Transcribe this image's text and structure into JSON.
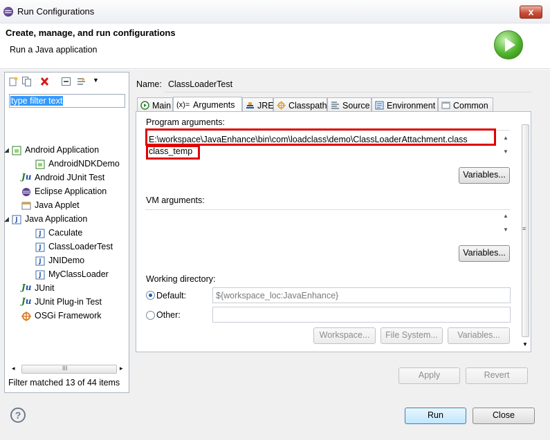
{
  "window": {
    "title": "Run Configurations",
    "close_glyph": "x"
  },
  "header": {
    "title": "Create, manage, and run configurations",
    "subtitle": "Run a Java application"
  },
  "left_panel": {
    "filter_text": "type filter text",
    "tree": [
      {
        "label": "Android Application",
        "icon": "android-app-icon",
        "expanded": true
      },
      {
        "label": "AndroidNDKDemo",
        "icon": "android-config-icon"
      },
      {
        "label": "Android JUnit Test",
        "icon": "junit-icon"
      },
      {
        "label": "Eclipse Application",
        "icon": "eclipse-icon"
      },
      {
        "label": "Java Applet",
        "icon": "applet-icon"
      },
      {
        "label": "Java Application",
        "icon": "java-app-icon",
        "expanded": true
      },
      {
        "label": "Caculate",
        "icon": "java-config-icon"
      },
      {
        "label": "ClassLoaderTest",
        "icon": "java-config-icon"
      },
      {
        "label": "JNIDemo",
        "icon": "java-config-icon"
      },
      {
        "label": "MyClassLoader",
        "icon": "java-config-icon"
      },
      {
        "label": "JUnit",
        "icon": "junit-icon"
      },
      {
        "label": "JUnit Plug-in Test",
        "icon": "junit-plugin-icon"
      },
      {
        "label": "OSGi Framework",
        "icon": "osgi-icon"
      }
    ],
    "scroll_glyph": "III",
    "status": "Filter matched 13 of 44 items"
  },
  "config": {
    "name_label": "Name:",
    "name_value": "ClassLoaderTest",
    "tabs": [
      {
        "label": "Main",
        "icon": "main-tab-icon"
      },
      {
        "label": "Arguments",
        "icon": "arguments-tab-icon",
        "active": true
      },
      {
        "label": "JRE",
        "icon": "jre-tab-icon"
      },
      {
        "label": "Classpath",
        "icon": "classpath-tab-icon"
      },
      {
        "label": "Source",
        "icon": "source-tab-icon"
      },
      {
        "label": "Environment",
        "icon": "environment-tab-icon"
      },
      {
        "label": "Common",
        "icon": "common-tab-icon"
      }
    ],
    "tab_prefix": "(x)=",
    "program_args_label": "Program arguments:",
    "program_args_lines": [
      "E:\\workspace\\JavaEnhance\\bin\\com\\loadclass\\demo\\ClassLoaderAttachment.class",
      "class_temp"
    ],
    "vm_args_label": "VM arguments:",
    "vm_args_value": "",
    "variables_label": "Variables...",
    "working_dir_label": "Working directory:",
    "default_label": "Default:",
    "default_value": "${workspace_loc:JavaEnhance}",
    "other_label": "Other:",
    "other_value": "",
    "workspace_btn": "Workspace...",
    "filesystem_btn": "File System...",
    "variables_btn2": "Variables...",
    "apply_btn": "Apply",
    "revert_btn": "Revert",
    "highlight_color": "#e00000"
  },
  "footer": {
    "run_btn": "Run",
    "close_btn": "Close",
    "help_glyph": "?"
  }
}
